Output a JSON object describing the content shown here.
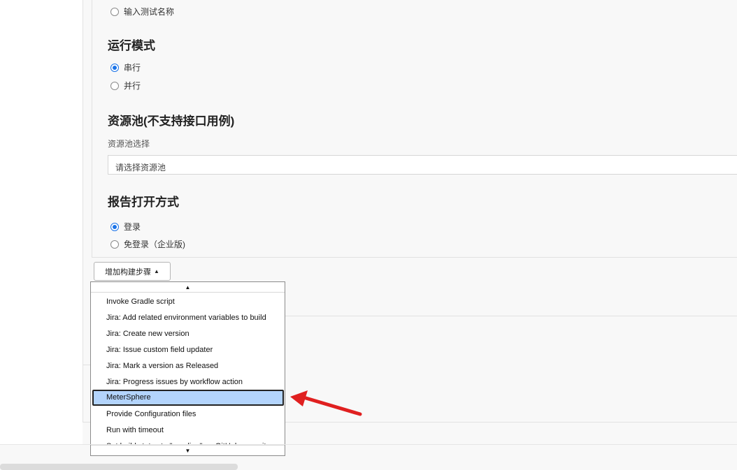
{
  "test_name_option": {
    "label": "输入测试名称",
    "checked": false
  },
  "run_mode": {
    "title": "运行模式",
    "options": [
      {
        "label": "串行",
        "checked": true
      },
      {
        "label": "并行",
        "checked": false
      }
    ]
  },
  "resource_pool": {
    "title": "资源池(不支持接口用例)",
    "field_label": "资源池选择",
    "placeholder": "请选择资源池"
  },
  "report_open": {
    "title": "报告打开方式",
    "options": [
      {
        "label": "登录",
        "checked": true
      },
      {
        "label": "免登录（企业版)",
        "checked": false
      }
    ]
  },
  "add_step": {
    "label": "增加构建步骤",
    "caret": "▲"
  },
  "dropdown": {
    "scroll_up": "▲",
    "scroll_down": "▼",
    "items": [
      "Invoke Gradle script",
      "Jira: Add related environment variables to build",
      "Jira: Create new version",
      "Jira: Issue custom field updater",
      "Jira: Mark a version as Released",
      "Jira: Progress issues by workflow action",
      "MeterSphere",
      "Provide Configuration files",
      "Run with timeout",
      "Set build status to \"pending\" on GitHub commit"
    ],
    "highlighted": "MeterSphere"
  },
  "colors": {
    "accent": "#1a73e8",
    "highlight": "#b3d4fc",
    "arrow": "#e02020"
  }
}
